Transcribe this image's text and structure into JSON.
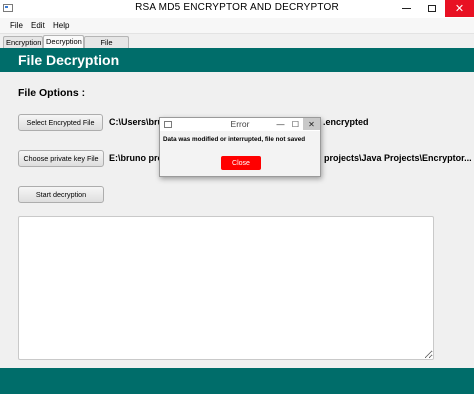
{
  "window": {
    "title": "RSA MD5 ENCRYPTOR AND DECRYPTOR",
    "icon": "app-window-icon",
    "controls": {
      "minimize": "—",
      "maximize": "☐",
      "close": "✕"
    }
  },
  "menubar": {
    "items": [
      {
        "label": "File"
      },
      {
        "label": "Edit"
      },
      {
        "label": "Help"
      }
    ]
  },
  "tabs": [
    {
      "label": "Encryption",
      "active": false
    },
    {
      "label": "Decryption",
      "active": true
    },
    {
      "label": "File Manager",
      "active": false
    }
  ],
  "banner": {
    "title": "File Decryption"
  },
  "file_options": {
    "title": "File Options :",
    "select_encrypted_button": "Select Encrypted File",
    "encrypted_path_left": "C:\\Users\\bru",
    "encrypted_path_right": ".encrypted",
    "choose_key_button": "Choose private key File",
    "key_path_left": "E:\\bruno pro",
    "key_path_right": "al projects\\Java Projects\\Encryptor...",
    "start_button": "Start decryption"
  },
  "output": {
    "value": ""
  },
  "dialog": {
    "title": "Error",
    "message": "Data was modified or interrupted, file not saved",
    "close_button": "Close",
    "controls": {
      "minimize": "—",
      "maximize": "☐",
      "close": "✕"
    }
  },
  "colors": {
    "brand": "#006d6a",
    "close_button": "#ff0000",
    "window_close": "#e81123"
  }
}
